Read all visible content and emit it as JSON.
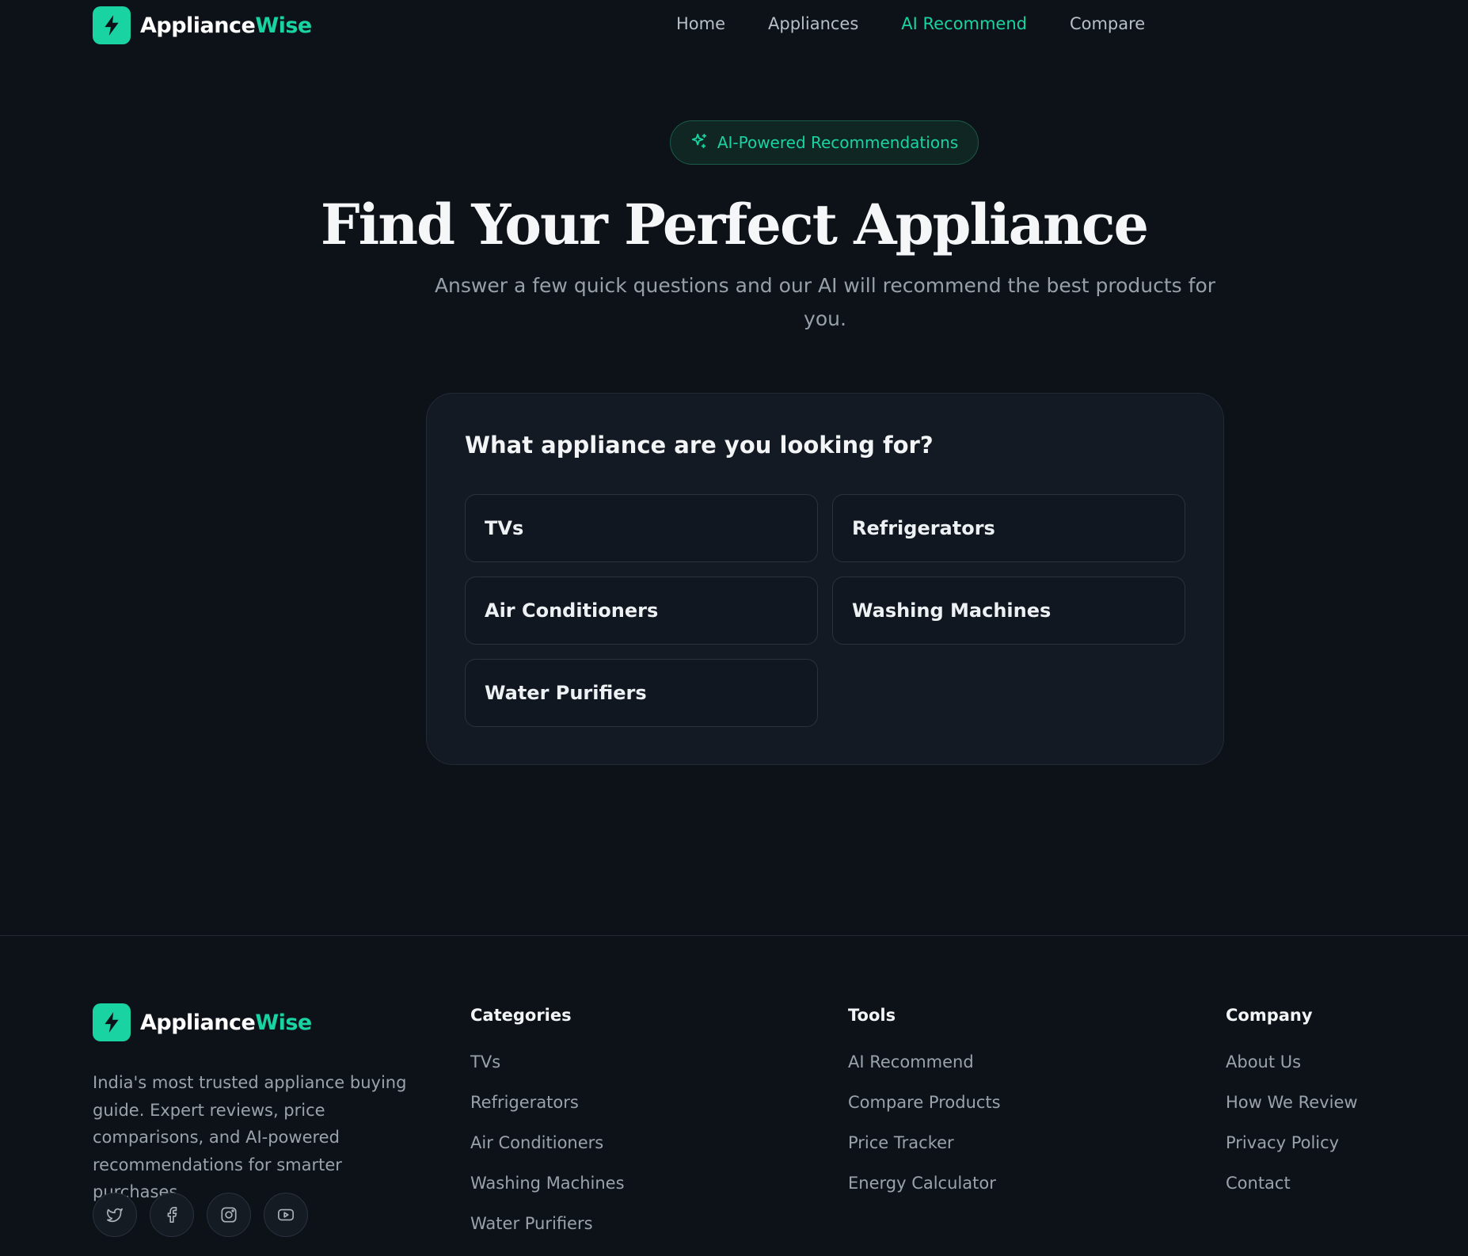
{
  "header": {
    "logo": {
      "primary": "Appliance",
      "accent": "Wise"
    },
    "nav": [
      {
        "label": "Home",
        "active": false
      },
      {
        "label": "Appliances",
        "active": false
      },
      {
        "label": "AI Recommend",
        "active": true
      },
      {
        "label": "Compare",
        "active": false
      }
    ]
  },
  "hero": {
    "badge": "AI-Powered Recommendations",
    "title": "Find Your Perfect Appliance",
    "subtitle": "Answer a few quick questions and our AI will recommend the best products for you."
  },
  "question": {
    "title": "What appliance are you looking for?",
    "options": [
      "TVs",
      "Refrigerators",
      "Air Conditioners",
      "Washing Machines",
      "Water Purifiers"
    ]
  },
  "footer": {
    "logo": {
      "primary": "Appliance",
      "accent": "Wise"
    },
    "description": "India's most trusted appliance buying guide. Expert reviews, price comparisons, and AI-powered recommendations for smarter purchases.",
    "social_icons": [
      "twitter-icon",
      "facebook-icon",
      "instagram-icon",
      "youtube-icon"
    ],
    "columns": [
      {
        "title": "Categories",
        "links": [
          "TVs",
          "Refrigerators",
          "Air Conditioners",
          "Washing Machines",
          "Water Purifiers"
        ]
      },
      {
        "title": "Tools",
        "links": [
          "AI Recommend",
          "Compare Products",
          "Price Tracker",
          "Energy Calculator"
        ]
      },
      {
        "title": "Company",
        "links": [
          "About Us",
          "How We Review",
          "Privacy Policy",
          "Contact"
        ]
      }
    ]
  },
  "colors": {
    "background": "#0d1218",
    "accent": "#19d3a2",
    "card": "#141a24"
  }
}
